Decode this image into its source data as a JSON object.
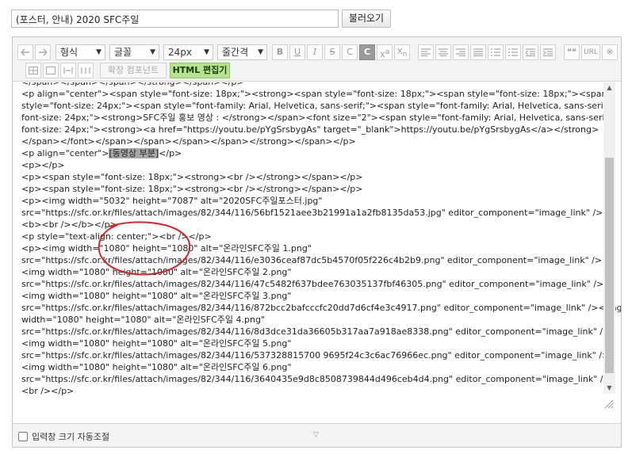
{
  "header": {
    "title_value": "(포스터, 안내) 2020 SFC주일",
    "load_button": "불러오기"
  },
  "toolbar": {
    "undo_icon": "undo-arrow-icon",
    "redo_icon": "redo-arrow-icon",
    "format_select": "형식",
    "font_select": "글꼴",
    "size_select": "24px",
    "line_spacing_select": "줄간격",
    "bold": "B",
    "underline": "U",
    "italic": "I",
    "strike": "S",
    "text_color": "C",
    "bg_color": "C",
    "superscript": "X",
    "superscript_small": "a",
    "subscript": "X",
    "subscript_small": "n",
    "quote": "❝❝",
    "url": "URL",
    "special_char": "※",
    "extend_component": "확장 컴포넌트",
    "html_edit": "HTML 편집기"
  },
  "code_lines": [
    "</span></span></span></strong></span></p>",
    "<p align=\"center\"><span style=\"font-size: 18px;\"><strong><span style=\"font-size: 18px;\"><span style=\"font-size: 18px;\"><span",
    "style=\"font-size: 24px;\"><span style=\"font-family: Arial, Helvetica, sans-serif;\"><span style=\"font-family: Arial, Helvetica, sans-serif;",
    "font-size: 24px;\"><strong>SFC주일 홍보 영상 : </strong></span><font size=\"2\"><span style=\"font-family: Arial, Helvetica, sans-serif;",
    "font-size: 24px;\"><strong><a href=\"https://youtu.be/pYgSrsbygAs\" target=\"_blank\">https://youtu.be/pYgSrsbygAs</a></strong>",
    "</span></font></span></span></span></span></strong></span></p>",
    "<p align=\"center\">[동영상 부분]</p>",
    "<p></p>",
    "<p><span style=\"font-size: 18px;\"><strong><br /></strong></span></p>",
    "<p><span style=\"font-size: 18px;\"><strong><br /></strong></span></p>",
    "<p><img width=\"5032\" height=\"7087\" alt=\"2020SFC주일포스터.jpg\"",
    "src=\"https://sfc.or.kr/files/attach/images/82/344/116/56bf1521aee3b21991a1a2fb8135da53.jpg\" editor_component=\"image_link\" />",
    "<b><br /></b></p>",
    "<p style=\"text-align: center;\"><br /></p>",
    "<p><img width=\"1080\" height=\"1080\" alt=\"온라인SFC주일 1.png\"",
    "src=\"https://sfc.or.kr/files/attach/images/82/344/116/e3036ceaf87dc5b4570f05f226c4b2b9.png\" editor_component=\"image_link\" />",
    "<img width=\"1080\" height=\"1080\" alt=\"온라인SFC주일 2.png\"",
    "src=\"https://sfc.or.kr/files/attach/images/82/344/116/47c5482f637bdee763035137fbf46305.png\" editor_component=\"image_link\" />",
    "<img width=\"1080\" height=\"1080\" alt=\"온라인SFC주일 3.png\"",
    "src=\"https://sfc.or.kr/files/attach/images/82/344/116/872bcc2bafcccfc20dd7d6cf4e3c4917.png\" editor_component=\"image_link\" /><img",
    "width=\"1080\" height=\"1080\" alt=\"온라인SFC주일 4.png\"",
    "src=\"https://sfc.or.kr/files/attach/images/82/344/116/8d3dce31da36605b317aa7a918ae8338.png\" editor_component=\"image_link\" />",
    "<img width=\"1080\" height=\"1080\" alt=\"온라인SFC주일 5.png\"",
    "src=\"https://sfc.or.kr/files/attach/images/82/344/116/537328815700 9695f24c3c6ac76966ec.png\" editor_component=\"image_link\" />",
    "<img width=\"1080\" height=\"1080\" alt=\"온라인SFC주일 6.png\"",
    "src=\"https://sfc.or.kr/files/attach/images/82/344/116/3640435e9d8c8508739844d496ceb4d4.png\" editor_component=\"image_link\" />",
    "<br /></p>"
  ],
  "highlight_text": "[동영상 부분]",
  "footer": {
    "auto_resize_label": "입력창 크기 자동조절",
    "auto_resize_checked": false,
    "handle_glyph": "▽"
  },
  "colors": {
    "html_editor_active": "#b6e38d",
    "annotation_circle": "#e02020",
    "spell_underline": "#e03a3a",
    "highlight": "#a8a8a8"
  },
  "icons": {
    "scroll_up": "scroll-up-arrow-icon",
    "scroll_down": "scroll-down-arrow-icon",
    "resize": "resize-grip-icon"
  }
}
